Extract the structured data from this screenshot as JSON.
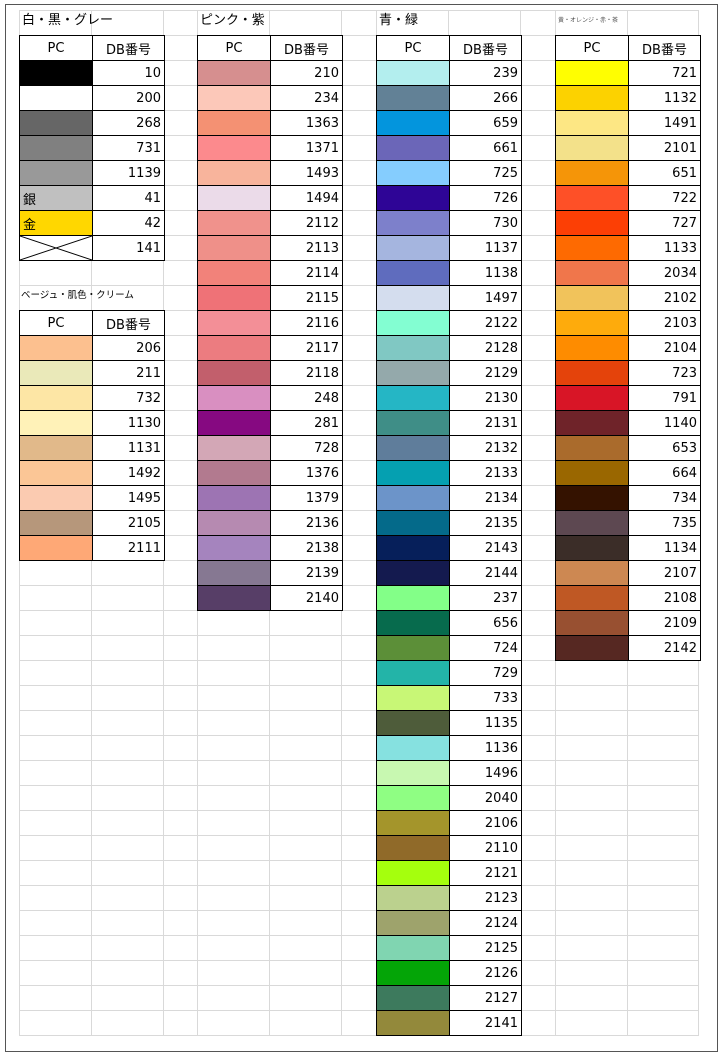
{
  "header_pc": "PC",
  "header_db": "DB番号",
  "groups": [
    {
      "title": "白・黒・グレー",
      "rows": [
        {
          "color": "#000000",
          "db": "10"
        },
        {
          "color": "#ffffff",
          "db": "200"
        },
        {
          "color": "#666666",
          "db": "268"
        },
        {
          "color": "#808080",
          "db": "731"
        },
        {
          "color": "#999999",
          "db": "1139"
        },
        {
          "color": "#c0c0c0",
          "db": "41",
          "label": "銀"
        },
        {
          "color": "#ffd700",
          "db": "42",
          "label": "金"
        },
        {
          "color": "#ffffff",
          "db": "141",
          "icon": "cross-icon"
        }
      ]
    },
    {
      "title": "ベージュ・肌色・クリーム",
      "rows": [
        {
          "color": "#fcc08f",
          "db": "206"
        },
        {
          "color": "#eae9b9",
          "db": "211"
        },
        {
          "color": "#fde6a5",
          "db": "732"
        },
        {
          "color": "#fff2b8",
          "db": "1130"
        },
        {
          "color": "#e1b98a",
          "db": "1131"
        },
        {
          "color": "#fbc696",
          "db": "1492"
        },
        {
          "color": "#fbcbb1",
          "db": "1495"
        },
        {
          "color": "#b6977b",
          "db": "2105"
        },
        {
          "color": "#fea876",
          "db": "2111"
        }
      ]
    },
    {
      "title": "ピンク・紫",
      "rows": [
        {
          "color": "#d68f8f",
          "db": "210"
        },
        {
          "color": "#fcc8b9",
          "db": "234"
        },
        {
          "color": "#f49173",
          "db": "1363"
        },
        {
          "color": "#fc8a8d",
          "db": "1371"
        },
        {
          "color": "#f8b49c",
          "db": "1493"
        },
        {
          "color": "#ebdbe9",
          "db": "1494"
        },
        {
          "color": "#f0928c",
          "db": "2112"
        },
        {
          "color": "#ef9089",
          "db": "2113"
        },
        {
          "color": "#f2827a",
          "db": "2114"
        },
        {
          "color": "#ef7277",
          "db": "2115"
        },
        {
          "color": "#f38f97",
          "db": "2116"
        },
        {
          "color": "#ec7c80",
          "db": "2117"
        },
        {
          "color": "#c25f6c",
          "db": "2118"
        },
        {
          "color": "#d98fc1",
          "db": "248"
        },
        {
          "color": "#860981",
          "db": "281"
        },
        {
          "color": "#d3a7b6",
          "db": "728"
        },
        {
          "color": "#b27a8f",
          "db": "1376"
        },
        {
          "color": "#9d74b3",
          "db": "1379"
        },
        {
          "color": "#b68ab1",
          "db": "2136"
        },
        {
          "color": "#a584be",
          "db": "2138"
        },
        {
          "color": "#867892",
          "db": "2139"
        },
        {
          "color": "#573e67",
          "db": "2140"
        }
      ]
    },
    {
      "title": "青・緑",
      "rows": [
        {
          "color": "#b3eeee",
          "db": "239"
        },
        {
          "color": "#628196",
          "db": "266"
        },
        {
          "color": "#0395dd",
          "db": "659"
        },
        {
          "color": "#6b66b8",
          "db": "661"
        },
        {
          "color": "#85cdfe",
          "db": "725"
        },
        {
          "color": "#2e0596",
          "db": "726"
        },
        {
          "color": "#7d80cb",
          "db": "730"
        },
        {
          "color": "#a5b5df",
          "db": "1137"
        },
        {
          "color": "#5f6cbe",
          "db": "1138"
        },
        {
          "color": "#d4ddee",
          "db": "1497"
        },
        {
          "color": "#83fed2",
          "db": "2122"
        },
        {
          "color": "#80c8c3",
          "db": "2128"
        },
        {
          "color": "#94a9ab",
          "db": "2129"
        },
        {
          "color": "#25b6c5",
          "db": "2130"
        },
        {
          "color": "#3f8e87",
          "db": "2131"
        },
        {
          "color": "#5f7d9b",
          "db": "2132"
        },
        {
          "color": "#05a0b1",
          "db": "2133"
        },
        {
          "color": "#6c94c9",
          "db": "2134"
        },
        {
          "color": "#046a8a",
          "db": "2135"
        },
        {
          "color": "#061f5a",
          "db": "2143"
        },
        {
          "color": "#141a4f",
          "db": "2144"
        },
        {
          "color": "#83ff88",
          "db": "237"
        },
        {
          "color": "#076b4d",
          "db": "656"
        },
        {
          "color": "#5c8f38",
          "db": "724"
        },
        {
          "color": "#23b4a8",
          "db": "729"
        },
        {
          "color": "#c8f776",
          "db": "733"
        },
        {
          "color": "#4e5c3a",
          "db": "1135"
        },
        {
          "color": "#86e1e0",
          "db": "1136"
        },
        {
          "color": "#c8f8b1",
          "db": "1496"
        },
        {
          "color": "#8ffe83",
          "db": "2040"
        },
        {
          "color": "#a4952b",
          "db": "2106"
        },
        {
          "color": "#906a29",
          "db": "2110"
        },
        {
          "color": "#a5ff0d",
          "db": "2121"
        },
        {
          "color": "#bbd18e",
          "db": "2123"
        },
        {
          "color": "#9ea36c",
          "db": "2124"
        },
        {
          "color": "#80d5b1",
          "db": "2125"
        },
        {
          "color": "#04a507",
          "db": "2126"
        },
        {
          "color": "#3d7a5d",
          "db": "2127"
        },
        {
          "color": "#93893b",
          "db": "2141"
        }
      ]
    },
    {
      "title": "黄・オレンジ・赤・茶",
      "rows": [
        {
          "color": "#fffe01",
          "db": "721"
        },
        {
          "color": "#fcd200",
          "db": "1132"
        },
        {
          "color": "#fde784",
          "db": "1491"
        },
        {
          "color": "#f3e18a",
          "db": "2101"
        },
        {
          "color": "#f59508",
          "db": "651"
        },
        {
          "color": "#fe5027",
          "db": "722"
        },
        {
          "color": "#fc3f05",
          "db": "727"
        },
        {
          "color": "#fe6a01",
          "db": "1133"
        },
        {
          "color": "#f0764b",
          "db": "2034"
        },
        {
          "color": "#f1c35b",
          "db": "2102"
        },
        {
          "color": "#feab0c",
          "db": "2103"
        },
        {
          "color": "#fe8c00",
          "db": "2104"
        },
        {
          "color": "#e4430b",
          "db": "723"
        },
        {
          "color": "#d81526",
          "db": "791"
        },
        {
          "color": "#6f2329",
          "db": "1140"
        },
        {
          "color": "#aa6b2c",
          "db": "653"
        },
        {
          "color": "#9a6700",
          "db": "664"
        },
        {
          "color": "#341200",
          "db": "734"
        },
        {
          "color": "#5d4851",
          "db": "735"
        },
        {
          "color": "#3b2d28",
          "db": "1134"
        },
        {
          "color": "#cd8852",
          "db": "2107"
        },
        {
          "color": "#bf5824",
          "db": "2108"
        },
        {
          "color": "#985031",
          "db": "2109"
        },
        {
          "color": "#562822",
          "db": "2142"
        }
      ]
    }
  ]
}
